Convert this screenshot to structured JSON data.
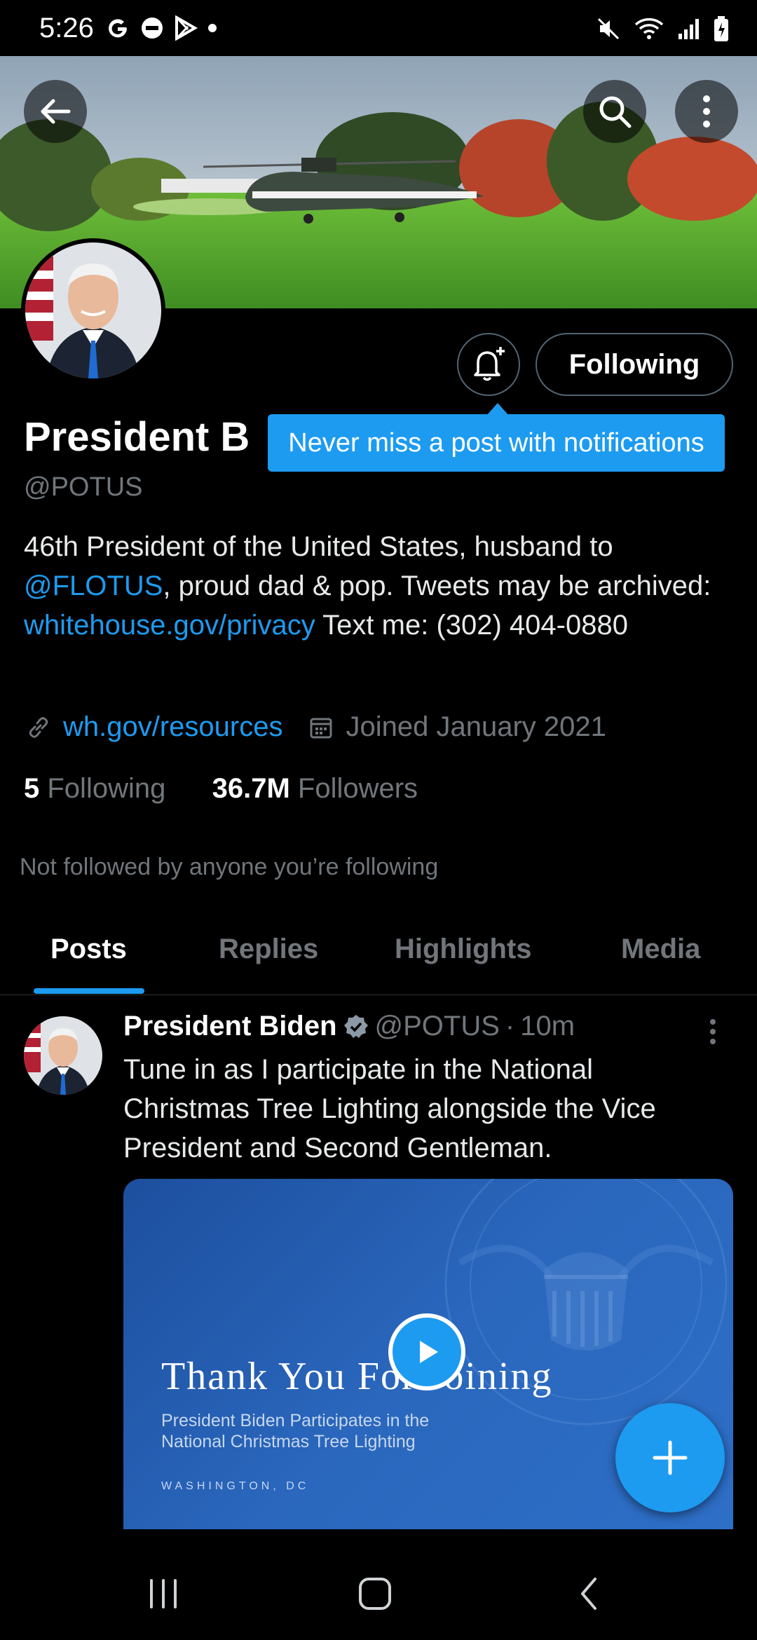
{
  "status_bar": {
    "time": "5:26",
    "left_icons": [
      "google-icon",
      "dnd-icon",
      "play-store-icon",
      "dot-icon"
    ],
    "right_icons": [
      "mute-icon",
      "wifi-icon",
      "signal-icon",
      "battery-icon"
    ]
  },
  "header": {
    "back_icon": "arrow-left-icon",
    "search_icon": "search-icon",
    "more_icon": "more-vertical-icon"
  },
  "profile": {
    "display_name": "President B",
    "handle": "@POTUS",
    "bio": {
      "part1": "46th President of the United States, husband to ",
      "mention": "@FLOTUS",
      "part2": ", proud dad & pop. Tweets may be archived: ",
      "link": "whitehouse.gov/privacy",
      "part3": " Text me: (302) 404-0880"
    },
    "website": "wh.gov/resources",
    "joined": "Joined January 2021",
    "following_count": "5",
    "following_label": "Following",
    "followers_count": "36.7M",
    "followers_label": "Followers",
    "not_followed": "Not followed by anyone you’re following",
    "follow_button": "Following",
    "tooltip": "Never miss a post with notifications"
  },
  "tabs": [
    {
      "label": "Posts",
      "active": true
    },
    {
      "label": "Replies",
      "active": false
    },
    {
      "label": "Highlights",
      "active": false
    },
    {
      "label": "Media",
      "active": false
    }
  ],
  "post": {
    "author": "President Biden",
    "handle": "@POTUS",
    "separator": "·",
    "time": "10m",
    "text": "Tune in as I participate in the National Christmas Tree Lighting alongside the Vice President and Second Gentleman.",
    "media": {
      "title": "Thank You For Joining",
      "subtitle": "President Biden Participates in the National Christmas Tree Lighting",
      "location": "WASHINGTON, DC"
    }
  },
  "colors": {
    "accent": "#1d9bf0",
    "background": "#000000",
    "muted_text": "#71767b"
  }
}
